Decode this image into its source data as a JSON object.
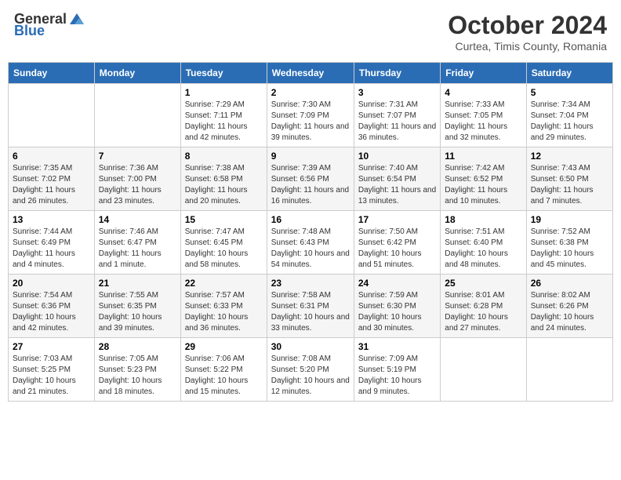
{
  "header": {
    "logo_general": "General",
    "logo_blue": "Blue",
    "month_title": "October 2024",
    "subtitle": "Curtea, Timis County, Romania"
  },
  "weekdays": [
    "Sunday",
    "Monday",
    "Tuesday",
    "Wednesday",
    "Thursday",
    "Friday",
    "Saturday"
  ],
  "weeks": [
    [
      {
        "day": "",
        "sunrise": "",
        "sunset": "",
        "daylight": ""
      },
      {
        "day": "",
        "sunrise": "",
        "sunset": "",
        "daylight": ""
      },
      {
        "day": "1",
        "sunrise": "Sunrise: 7:29 AM",
        "sunset": "Sunset: 7:11 PM",
        "daylight": "Daylight: 11 hours and 42 minutes."
      },
      {
        "day": "2",
        "sunrise": "Sunrise: 7:30 AM",
        "sunset": "Sunset: 7:09 PM",
        "daylight": "Daylight: 11 hours and 39 minutes."
      },
      {
        "day": "3",
        "sunrise": "Sunrise: 7:31 AM",
        "sunset": "Sunset: 7:07 PM",
        "daylight": "Daylight: 11 hours and 36 minutes."
      },
      {
        "day": "4",
        "sunrise": "Sunrise: 7:33 AM",
        "sunset": "Sunset: 7:05 PM",
        "daylight": "Daylight: 11 hours and 32 minutes."
      },
      {
        "day": "5",
        "sunrise": "Sunrise: 7:34 AM",
        "sunset": "Sunset: 7:04 PM",
        "daylight": "Daylight: 11 hours and 29 minutes."
      }
    ],
    [
      {
        "day": "6",
        "sunrise": "Sunrise: 7:35 AM",
        "sunset": "Sunset: 7:02 PM",
        "daylight": "Daylight: 11 hours and 26 minutes."
      },
      {
        "day": "7",
        "sunrise": "Sunrise: 7:36 AM",
        "sunset": "Sunset: 7:00 PM",
        "daylight": "Daylight: 11 hours and 23 minutes."
      },
      {
        "day": "8",
        "sunrise": "Sunrise: 7:38 AM",
        "sunset": "Sunset: 6:58 PM",
        "daylight": "Daylight: 11 hours and 20 minutes."
      },
      {
        "day": "9",
        "sunrise": "Sunrise: 7:39 AM",
        "sunset": "Sunset: 6:56 PM",
        "daylight": "Daylight: 11 hours and 16 minutes."
      },
      {
        "day": "10",
        "sunrise": "Sunrise: 7:40 AM",
        "sunset": "Sunset: 6:54 PM",
        "daylight": "Daylight: 11 hours and 13 minutes."
      },
      {
        "day": "11",
        "sunrise": "Sunrise: 7:42 AM",
        "sunset": "Sunset: 6:52 PM",
        "daylight": "Daylight: 11 hours and 10 minutes."
      },
      {
        "day": "12",
        "sunrise": "Sunrise: 7:43 AM",
        "sunset": "Sunset: 6:50 PM",
        "daylight": "Daylight: 11 hours and 7 minutes."
      }
    ],
    [
      {
        "day": "13",
        "sunrise": "Sunrise: 7:44 AM",
        "sunset": "Sunset: 6:49 PM",
        "daylight": "Daylight: 11 hours and 4 minutes."
      },
      {
        "day": "14",
        "sunrise": "Sunrise: 7:46 AM",
        "sunset": "Sunset: 6:47 PM",
        "daylight": "Daylight: 11 hours and 1 minute."
      },
      {
        "day": "15",
        "sunrise": "Sunrise: 7:47 AM",
        "sunset": "Sunset: 6:45 PM",
        "daylight": "Daylight: 10 hours and 58 minutes."
      },
      {
        "day": "16",
        "sunrise": "Sunrise: 7:48 AM",
        "sunset": "Sunset: 6:43 PM",
        "daylight": "Daylight: 10 hours and 54 minutes."
      },
      {
        "day": "17",
        "sunrise": "Sunrise: 7:50 AM",
        "sunset": "Sunset: 6:42 PM",
        "daylight": "Daylight: 10 hours and 51 minutes."
      },
      {
        "day": "18",
        "sunrise": "Sunrise: 7:51 AM",
        "sunset": "Sunset: 6:40 PM",
        "daylight": "Daylight: 10 hours and 48 minutes."
      },
      {
        "day": "19",
        "sunrise": "Sunrise: 7:52 AM",
        "sunset": "Sunset: 6:38 PM",
        "daylight": "Daylight: 10 hours and 45 minutes."
      }
    ],
    [
      {
        "day": "20",
        "sunrise": "Sunrise: 7:54 AM",
        "sunset": "Sunset: 6:36 PM",
        "daylight": "Daylight: 10 hours and 42 minutes."
      },
      {
        "day": "21",
        "sunrise": "Sunrise: 7:55 AM",
        "sunset": "Sunset: 6:35 PM",
        "daylight": "Daylight: 10 hours and 39 minutes."
      },
      {
        "day": "22",
        "sunrise": "Sunrise: 7:57 AM",
        "sunset": "Sunset: 6:33 PM",
        "daylight": "Daylight: 10 hours and 36 minutes."
      },
      {
        "day": "23",
        "sunrise": "Sunrise: 7:58 AM",
        "sunset": "Sunset: 6:31 PM",
        "daylight": "Daylight: 10 hours and 33 minutes."
      },
      {
        "day": "24",
        "sunrise": "Sunrise: 7:59 AM",
        "sunset": "Sunset: 6:30 PM",
        "daylight": "Daylight: 10 hours and 30 minutes."
      },
      {
        "day": "25",
        "sunrise": "Sunrise: 8:01 AM",
        "sunset": "Sunset: 6:28 PM",
        "daylight": "Daylight: 10 hours and 27 minutes."
      },
      {
        "day": "26",
        "sunrise": "Sunrise: 8:02 AM",
        "sunset": "Sunset: 6:26 PM",
        "daylight": "Daylight: 10 hours and 24 minutes."
      }
    ],
    [
      {
        "day": "27",
        "sunrise": "Sunrise: 7:03 AM",
        "sunset": "Sunset: 5:25 PM",
        "daylight": "Daylight: 10 hours and 21 minutes."
      },
      {
        "day": "28",
        "sunrise": "Sunrise: 7:05 AM",
        "sunset": "Sunset: 5:23 PM",
        "daylight": "Daylight: 10 hours and 18 minutes."
      },
      {
        "day": "29",
        "sunrise": "Sunrise: 7:06 AM",
        "sunset": "Sunset: 5:22 PM",
        "daylight": "Daylight: 10 hours and 15 minutes."
      },
      {
        "day": "30",
        "sunrise": "Sunrise: 7:08 AM",
        "sunset": "Sunset: 5:20 PM",
        "daylight": "Daylight: 10 hours and 12 minutes."
      },
      {
        "day": "31",
        "sunrise": "Sunrise: 7:09 AM",
        "sunset": "Sunset: 5:19 PM",
        "daylight": "Daylight: 10 hours and 9 minutes."
      },
      {
        "day": "",
        "sunrise": "",
        "sunset": "",
        "daylight": ""
      },
      {
        "day": "",
        "sunrise": "",
        "sunset": "",
        "daylight": ""
      }
    ]
  ]
}
